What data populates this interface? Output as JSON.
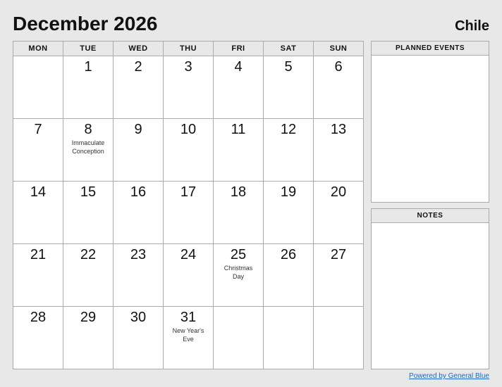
{
  "header": {
    "title": "December 2026",
    "country": "Chile"
  },
  "calendar": {
    "days_of_week": [
      "MON",
      "TUE",
      "WED",
      "THU",
      "FRI",
      "SAT",
      "SUN"
    ],
    "weeks": [
      [
        null,
        1,
        2,
        3,
        4,
        5,
        6
      ],
      [
        7,
        8,
        9,
        10,
        11,
        12,
        13
      ],
      [
        14,
        15,
        16,
        17,
        18,
        19,
        20
      ],
      [
        21,
        22,
        23,
        24,
        25,
        26,
        27
      ],
      [
        28,
        29,
        30,
        31,
        null,
        null,
        null
      ]
    ],
    "events": {
      "8": "Immaculate Conception",
      "25": "Christmas Day",
      "31": "New Year's Eve"
    }
  },
  "sidebar": {
    "planned_events_label": "PLANNED EVENTS",
    "notes_label": "NOTES"
  },
  "footer": {
    "link_text": "Powered by General Blue"
  }
}
